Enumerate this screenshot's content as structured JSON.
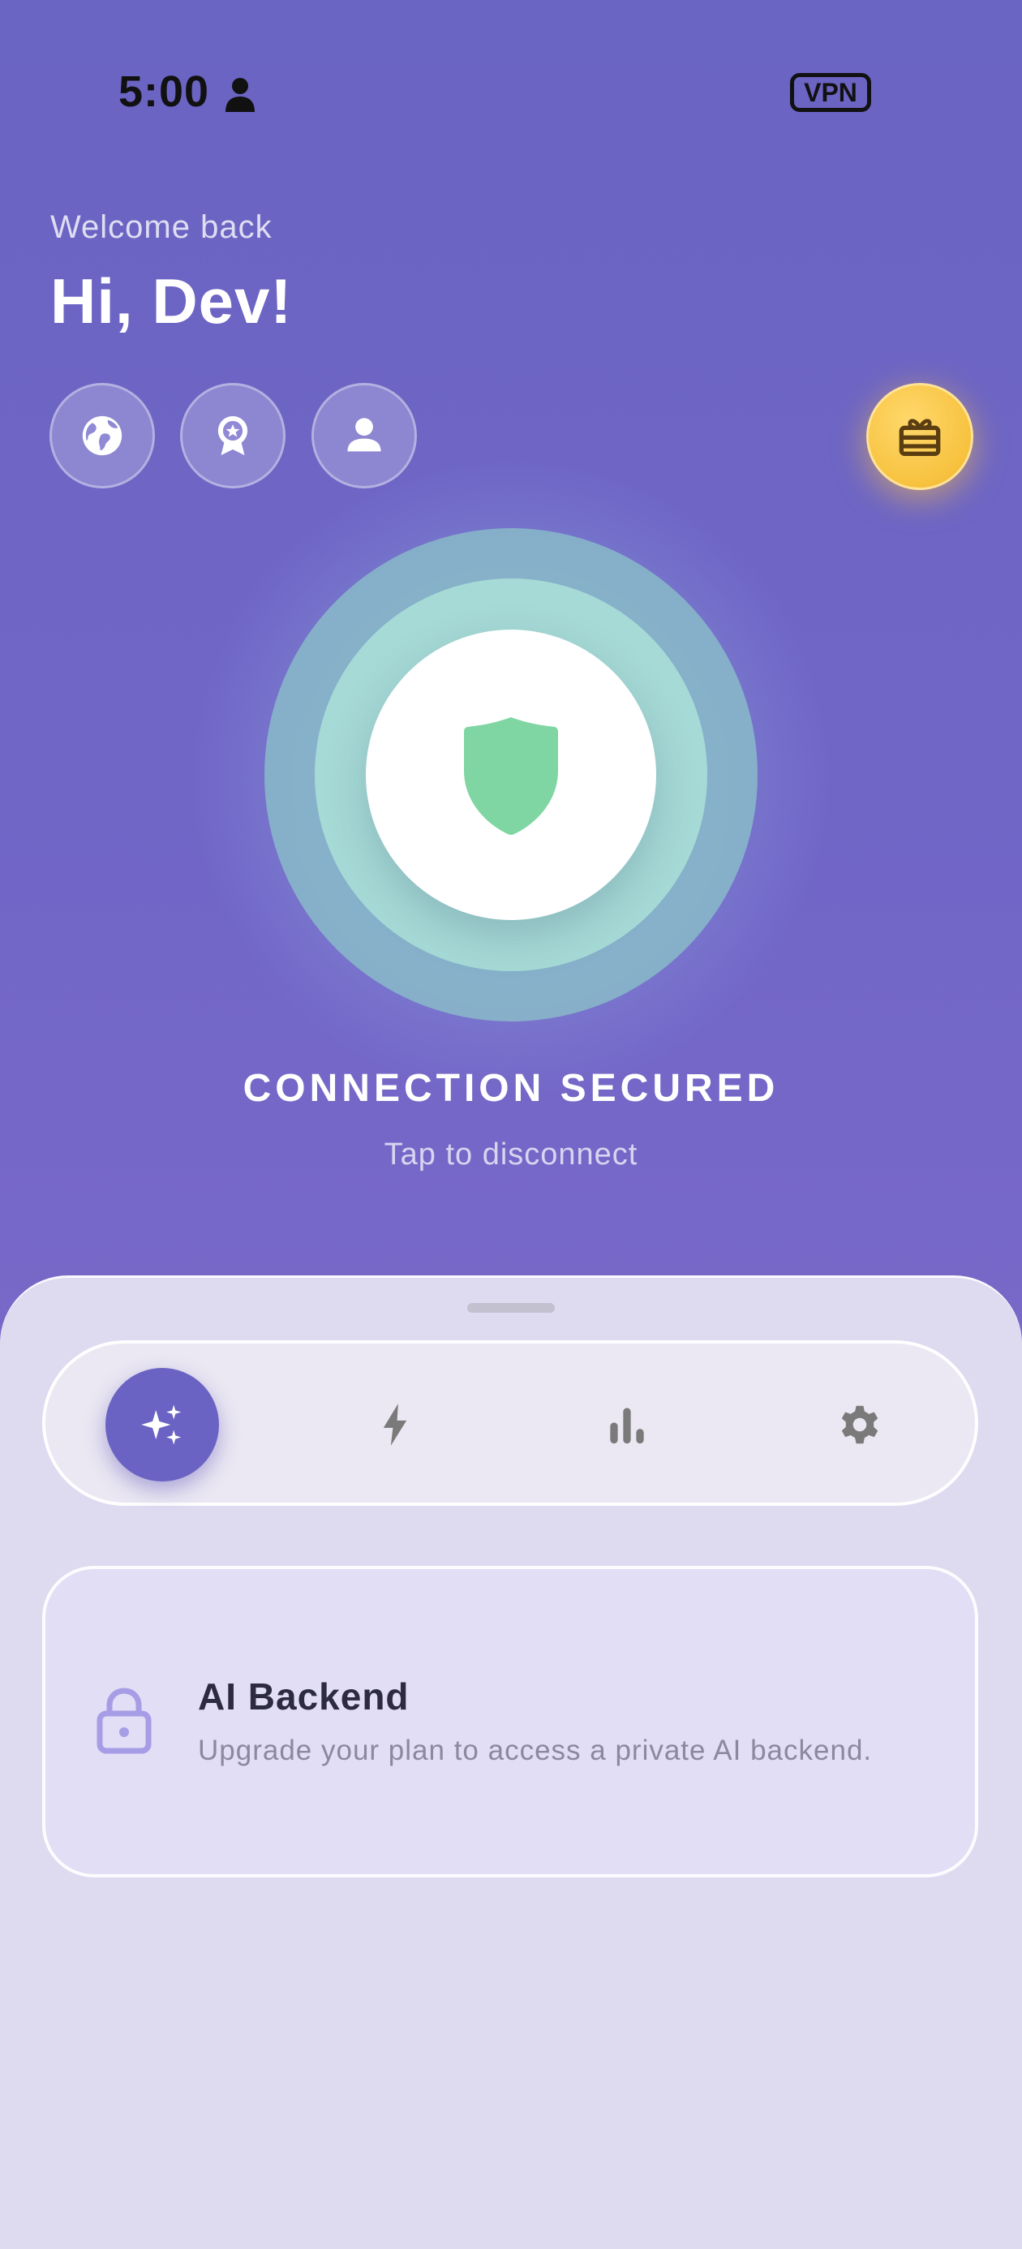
{
  "status_bar": {
    "time": "5:00",
    "vpn_badge": "VPN"
  },
  "header": {
    "welcome": "Welcome back",
    "greeting": "Hi, Dev!"
  },
  "quick_actions": [
    {
      "icon": "globe-icon"
    },
    {
      "icon": "award-badge-icon"
    },
    {
      "icon": "profile-icon"
    }
  ],
  "gift": {
    "icon": "gift-icon"
  },
  "connection": {
    "status": "CONNECTION SECURED",
    "hint": "Tap to disconnect",
    "icon": "shield-icon"
  },
  "tabs": [
    {
      "icon": "sparkles-icon",
      "active": true
    },
    {
      "icon": "lightning-icon",
      "active": false
    },
    {
      "icon": "bar-chart-icon",
      "active": false
    },
    {
      "icon": "gear-icon",
      "active": false
    }
  ],
  "feature_card": {
    "icon": "lock-icon",
    "title": "AI Backend",
    "subtitle": "Upgrade your plan to access a private AI backend."
  },
  "colors": {
    "background": "#6a64c2",
    "accent": "#6a63c3",
    "shield": "#7fd6a2",
    "gift": "#f7c23f",
    "sheet": "#dedaf0"
  }
}
